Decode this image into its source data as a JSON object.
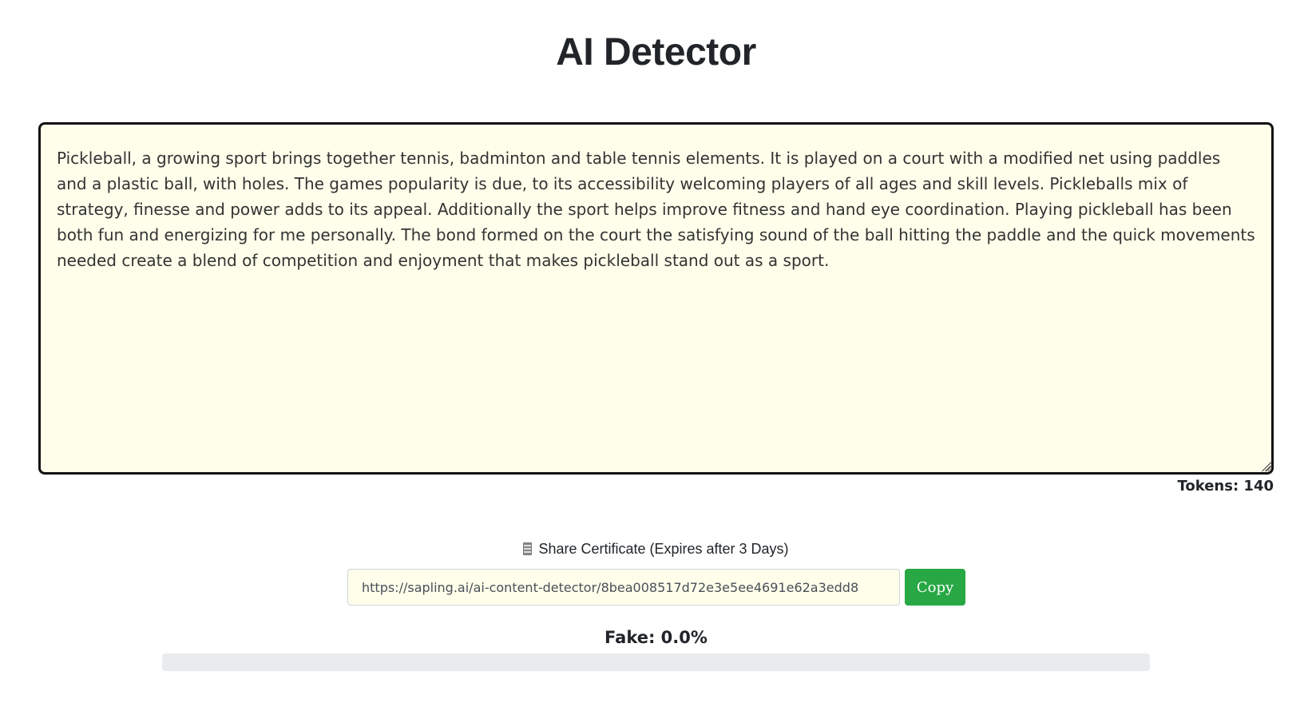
{
  "header": {
    "title": "AI Detector"
  },
  "editor": {
    "text": "Pickleball, a growing sport brings together tennis, badminton and table tennis elements. It is played on a court with a modified net using paddles and a plastic ball, with holes. The games popularity is due, to its accessibility welcoming players of all ages and skill levels. Pickleballs mix of strategy, finesse and power adds to its appeal. Additionally the sport helps improve fitness and hand eye coordination. Playing pickleball has been both fun and energizing for me personally. The bond formed on the court the satisfying sound of the ball hitting the paddle and the quick movements needed create a blend of competition and enjoyment that makes pickleball stand out as a sport.",
    "tokens_label": "Tokens: 140"
  },
  "share": {
    "icon": "document-icon",
    "label": "Share Certificate (Expires after 3 Days)",
    "url": "https://sapling.ai/ai-content-detector/8bea008517d72e3e5ee4691e62a3edd8",
    "copy_label": "Copy"
  },
  "result": {
    "fake_label": "Fake: 0.0%",
    "fake_fraction": 0.0
  },
  "colors": {
    "editor_bg": "#fefeeb",
    "copy_button": "#28a745",
    "progress_track": "#e9ecef"
  }
}
